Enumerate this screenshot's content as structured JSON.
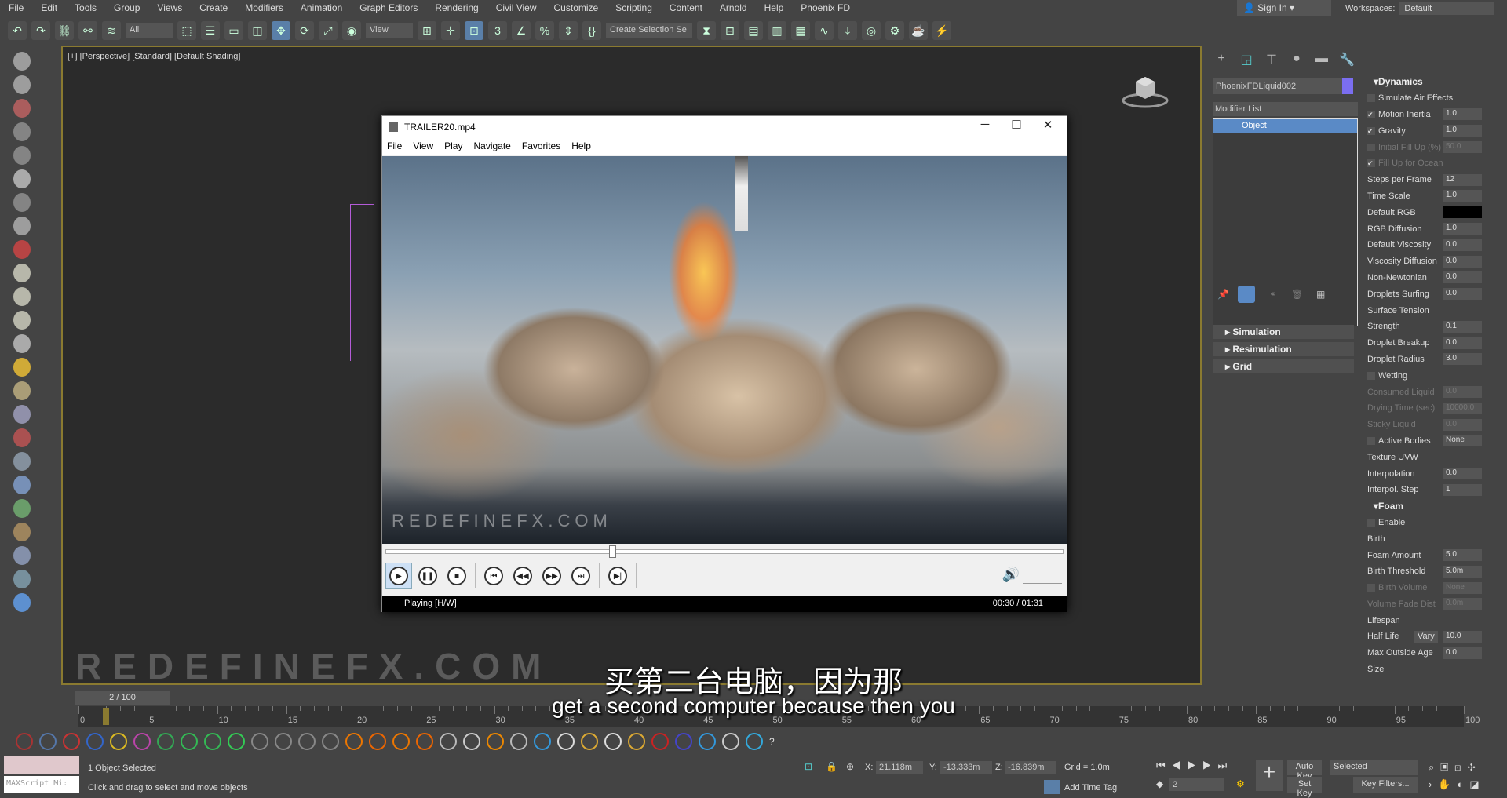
{
  "menu": [
    "File",
    "Edit",
    "Tools",
    "Group",
    "Views",
    "Create",
    "Modifiers",
    "Animation",
    "Graph Editors",
    "Rendering",
    "Civil View",
    "Customize",
    "Scripting",
    "Content",
    "Arnold",
    "Help",
    "Phoenix FD"
  ],
  "signin": "Sign In",
  "workspaces": {
    "label": "Workspaces:",
    "value": "Default"
  },
  "toolbar": {
    "filter": "All",
    "refcoord": "View",
    "selset": "Create Selection Se"
  },
  "viewport": {
    "label": "[+] [Perspective] [Standard] [Default Shading]",
    "watermark": "REDEFINEFX.COM"
  },
  "player": {
    "title": "TRAILER20.mp4",
    "menu": [
      "File",
      "View",
      "Play",
      "Navigate",
      "Favorites",
      "Help"
    ],
    "video_watermark": "REDEFINEFX.COM",
    "progress": 0.33,
    "status": "Playing [H/W]",
    "time": "00:30 / 01:31"
  },
  "subtitles": {
    "cn": "买第二台电脑，因为那",
    "en": "get a second computer because then you"
  },
  "cmdpanel": {
    "object_name": "PhoenixFDLiquid002",
    "object_color": "#7b6ef0",
    "modifier_list": "Modifier List",
    "stack": [
      "Object"
    ],
    "rollouts": [
      "Simulation",
      "Resimulation",
      "Grid"
    ]
  },
  "dynamics": [
    {
      "type": "hdr",
      "label": "Dynamics"
    },
    {
      "label": "Simulate Air Effects",
      "cb": false
    },
    {
      "label": "Motion Inertia",
      "cb": true,
      "value": "1.0"
    },
    {
      "label": "Gravity",
      "cb": true,
      "value": "1.0"
    },
    {
      "label": "Initial Fill Up (%)",
      "cb": false,
      "value": "50.0",
      "dis": true
    },
    {
      "label": "Fill Up for Ocean",
      "cb": true,
      "dis": true
    },
    {
      "label": "Steps per Frame",
      "value": "12"
    },
    {
      "label": "Time Scale",
      "value": "1.0"
    },
    {
      "label": "Default RGB",
      "color": "#000000"
    },
    {
      "label": "RGB Diffusion",
      "value": "1.0"
    },
    {
      "label": "Default Viscosity",
      "value": "0.0"
    },
    {
      "label": "Viscosity Diffusion",
      "value": "0.0"
    },
    {
      "label": "Non-Newtonian",
      "value": "0.0"
    },
    {
      "label": "Droplets Surfing",
      "value": "0.0"
    },
    {
      "label": "Surface Tension"
    },
    {
      "label": "Strength",
      "value": "0.1"
    },
    {
      "label": "Droplet Breakup",
      "value": "0.0"
    },
    {
      "label": "Droplet Radius",
      "value": "3.0"
    },
    {
      "label": "Wetting",
      "cb": false
    },
    {
      "label": "Consumed Liquid",
      "value": "0.0",
      "dis": true
    },
    {
      "label": "Drying Time (sec)",
      "value": "10000.0",
      "dis": true
    },
    {
      "label": "Sticky Liquid",
      "value": "0.0",
      "dis": true
    },
    {
      "label": "Active Bodies",
      "cb": false,
      "value": "None"
    },
    {
      "label": "Texture UVW"
    },
    {
      "label": "Interpolation",
      "value": "0.0"
    },
    {
      "label": "Interpol. Step",
      "value": "1"
    },
    {
      "type": "hdr",
      "label": "Foam"
    },
    {
      "label": "Enable",
      "cb": false
    },
    {
      "label": "Birth"
    },
    {
      "label": "Foam Amount",
      "value": "5.0"
    },
    {
      "label": "Birth Threshold",
      "value": "5.0m"
    },
    {
      "label": "Birth Volume",
      "cb": false,
      "value": "None",
      "dis": true
    },
    {
      "label": "Volume Fade Dist",
      "value": "0.0m",
      "dis": true
    },
    {
      "label": "Lifespan"
    },
    {
      "label": "Half Life",
      "extra": "Vary",
      "value": "10.0"
    },
    {
      "label": "Max Outside Age",
      "value": "0.0"
    },
    {
      "label": "Size"
    }
  ],
  "timeline": {
    "frame": "2 / 100",
    "current": 2,
    "max": 100,
    "labels": [
      "0",
      "5",
      "10",
      "15",
      "20",
      "25",
      "30",
      "35",
      "40",
      "45",
      "50",
      "55",
      "60",
      "65",
      "70",
      "75",
      "80",
      "85",
      "90",
      "95",
      "100"
    ]
  },
  "status": {
    "selected": "1 Object Selected",
    "hint": "Click and drag to select and move objects",
    "maxscript": "MAXScript Mi:",
    "x_label": "X:",
    "x": "21.118m",
    "y_label": "Y:",
    "y": "-13.333m",
    "z_label": "Z:",
    "z": "-16.839m",
    "grid": "Grid = 1.0m",
    "add_time_tag": "Add Time Tag",
    "auto_key": "Auto Key",
    "set_key": "Set Key",
    "key_mode": "Selected",
    "key_filters": "Key Filters...",
    "frame_field": "2"
  }
}
